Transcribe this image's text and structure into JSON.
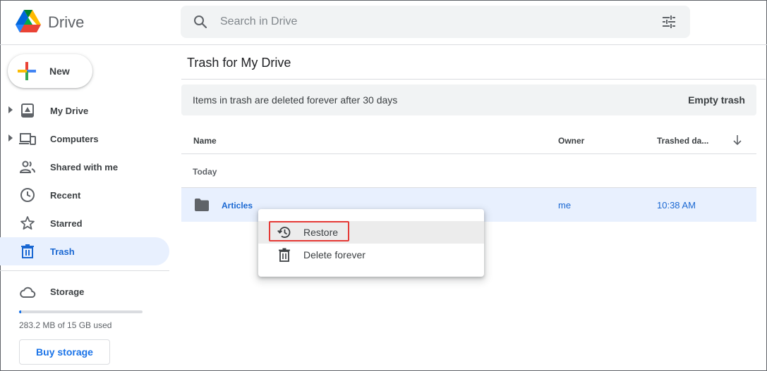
{
  "app": {
    "name": "Drive"
  },
  "search": {
    "placeholder": "Search in Drive"
  },
  "sidebar": {
    "new_label": "New",
    "items": [
      {
        "label": "My Drive",
        "icon": "my-drive-icon",
        "expandable": true
      },
      {
        "label": "Computers",
        "icon": "computers-icon",
        "expandable": true
      },
      {
        "label": "Shared with me",
        "icon": "shared-icon",
        "expandable": false
      },
      {
        "label": "Recent",
        "icon": "clock-icon",
        "expandable": false
      },
      {
        "label": "Starred",
        "icon": "star-icon",
        "expandable": false
      },
      {
        "label": "Trash",
        "icon": "trash-icon",
        "expandable": false,
        "active": true
      }
    ],
    "storage": {
      "label": "Storage",
      "used_text": "283.2 MB of 15 GB used",
      "used_fraction": 0.0189,
      "buy_label": "Buy storage"
    }
  },
  "main": {
    "title": "Trash for My Drive",
    "banner": {
      "text": "Items in trash are deleted forever after 30 days",
      "action": "Empty trash"
    },
    "columns": {
      "name": "Name",
      "owner": "Owner",
      "trashed": "Trashed da..."
    },
    "group": "Today",
    "rows": [
      {
        "name": "Articles",
        "owner": "me",
        "trashed": "10:38 AM",
        "type": "folder"
      }
    ]
  },
  "context_menu": {
    "items": [
      {
        "label": "Restore",
        "icon": "restore-icon"
      },
      {
        "label": "Delete forever",
        "icon": "trash-icon"
      }
    ]
  },
  "colors": {
    "accent": "#1a73e8",
    "active_bg": "#e8f0fe",
    "active_text": "#1967d2",
    "highlight_box": "#e53935"
  }
}
